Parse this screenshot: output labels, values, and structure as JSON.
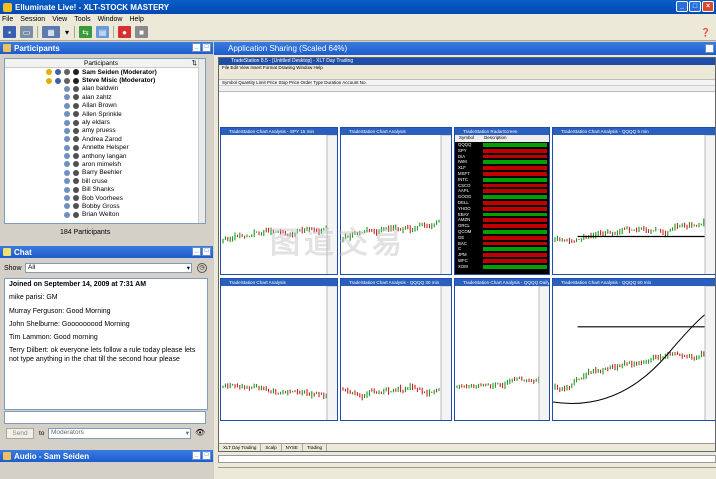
{
  "window": {
    "title": "Elluminate Live! - XLT-STOCK MASTERY"
  },
  "menu": [
    "File",
    "Session",
    "View",
    "Tools",
    "Window",
    "Help"
  ],
  "participants": {
    "panel_title": "Participants",
    "column_header": "Participants",
    "count_label": "184 Participants",
    "names": [
      "Sam Seiden (Moderator)",
      "Steve Misic (Moderator)",
      "alan baldwin",
      "alan zahtz",
      "Allan Brown",
      "Allen Sprinkle",
      "aly eldars",
      "amy pruess",
      "Andrea Zarod",
      "Annette Helsper",
      "anthony langan",
      "aron mimelsh",
      "Barry Beehler",
      "bill cruse",
      "Bill Shanks",
      "Bob Voorhees",
      "Bobby Gross",
      "Brian Welton"
    ]
  },
  "chat": {
    "panel_title": "Chat",
    "show_label": "Show",
    "show_value": "All",
    "messages": [
      "Joined on September 14, 2009 at 7:31 AM",
      "mike parisi: GM",
      "Murray Ferguson: Good Morning",
      "John Shelburne: Gooooooood Morning",
      "Tim Lammon: Good morning",
      "Terry Dilbert: ok everyone lets follow a rule today please lets not type anything in the chat till the second hour please"
    ],
    "send_label": "Send",
    "to_label": "to",
    "to_value": "Moderators"
  },
  "audio": {
    "panel_title": "Audio - Sam Seiden"
  },
  "app_sharing": {
    "title": "Application Sharing (Scaled 64%)",
    "inner_title": "TradeStation 8.5 - [Untitled Desktop] - XLT Day Trading",
    "inner_menu": "File Edit View Insert Format Drawing Window Help",
    "order_row": "Symbol  Quantity  Limit Price  Stop Price  Order Type  Duration  Account No.",
    "charts": [
      "TradeStation Chart Analysis - SPY 15 min",
      "TradeStation Chart Analysis",
      "TradeStation RadarScreen",
      "TradeStation Chart Analysis - QQQQ 5 min",
      "TradeStation Chart Analysis",
      "TradeStation Chart Analysis - QQQQ 30 min",
      "TradeStation Chart Analysis - QQQQ Daily",
      "TradeStation Chart Analysis - QQQQ 60 min"
    ],
    "tabs": [
      "XLT Day Trading",
      "Scalp",
      "NYSE",
      "Trading"
    ],
    "radar_header": [
      "Symbol",
      "Description"
    ],
    "radar_symbols": [
      "QQQQ",
      "SPY",
      "DIA",
      "IWM",
      "XLF",
      "MSFT",
      "INTC",
      "CSCO",
      "AAPL",
      "GOOG",
      "DELL",
      "YHOO",
      "EBAY",
      "AMZN",
      "ORCL",
      "QCOM",
      "GE",
      "BAC",
      "C",
      "JPM",
      "WFC",
      "XOM"
    ]
  },
  "watermark": "图道交易"
}
